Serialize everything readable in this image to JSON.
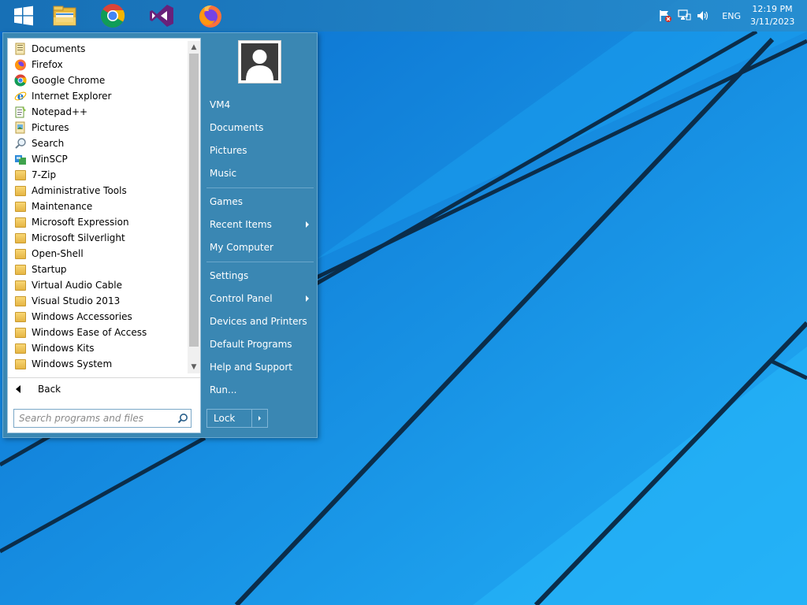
{
  "taskbar": {
    "pinned": [
      {
        "name": "start-button",
        "icon": "windows-logo-icon"
      },
      {
        "name": "file-explorer",
        "icon": "file-explorer-icon"
      },
      {
        "name": "google-chrome",
        "icon": "chrome-icon"
      },
      {
        "name": "visual-studio",
        "icon": "visual-studio-icon"
      },
      {
        "name": "firefox",
        "icon": "firefox-icon"
      }
    ],
    "tray": {
      "language": "ENG",
      "time": "12:19 PM",
      "date": "3/11/2023"
    }
  },
  "start_menu": {
    "programs": [
      {
        "label": "Documents",
        "icon": "documents-icon"
      },
      {
        "label": "Firefox",
        "icon": "firefox-icon"
      },
      {
        "label": "Google Chrome",
        "icon": "chrome-icon"
      },
      {
        "label": "Internet Explorer",
        "icon": "internet-explorer-icon"
      },
      {
        "label": "Notepad++",
        "icon": "notepad-plus-icon"
      },
      {
        "label": "Pictures",
        "icon": "pictures-icon"
      },
      {
        "label": "Search",
        "icon": "search-icon"
      },
      {
        "label": "WinSCP",
        "icon": "winscp-icon"
      },
      {
        "label": "7-Zip",
        "icon": "folder-icon"
      },
      {
        "label": "Administrative Tools",
        "icon": "folder-icon"
      },
      {
        "label": "Maintenance",
        "icon": "folder-icon"
      },
      {
        "label": "Microsoft Expression",
        "icon": "folder-icon"
      },
      {
        "label": "Microsoft Silverlight",
        "icon": "folder-icon"
      },
      {
        "label": "Open-Shell",
        "icon": "folder-icon"
      },
      {
        "label": "Startup",
        "icon": "folder-icon"
      },
      {
        "label": "Virtual Audio Cable",
        "icon": "folder-icon"
      },
      {
        "label": "Visual Studio 2013",
        "icon": "folder-icon"
      },
      {
        "label": "Windows Accessories",
        "icon": "folder-icon"
      },
      {
        "label": "Windows Ease of Access",
        "icon": "folder-icon"
      },
      {
        "label": "Windows Kits",
        "icon": "folder-icon"
      },
      {
        "label": "Windows System",
        "icon": "folder-icon"
      }
    ],
    "back_label": "Back",
    "search_placeholder": "Search programs and files",
    "right_items": {
      "user": "VM4",
      "documents": "Documents",
      "pictures": "Pictures",
      "music": "Music",
      "games": "Games",
      "recent_items": "Recent Items",
      "my_computer": "My Computer",
      "settings": "Settings",
      "control_panel": "Control Panel",
      "devices_printers": "Devices and Printers",
      "default_programs": "Default Programs",
      "help_support": "Help and Support",
      "run": "Run..."
    },
    "lock_label": "Lock"
  },
  "colors": {
    "menu_background": "#3a87b3",
    "desktop_blue": "#1596ea",
    "taskbar": "#1870b4"
  }
}
